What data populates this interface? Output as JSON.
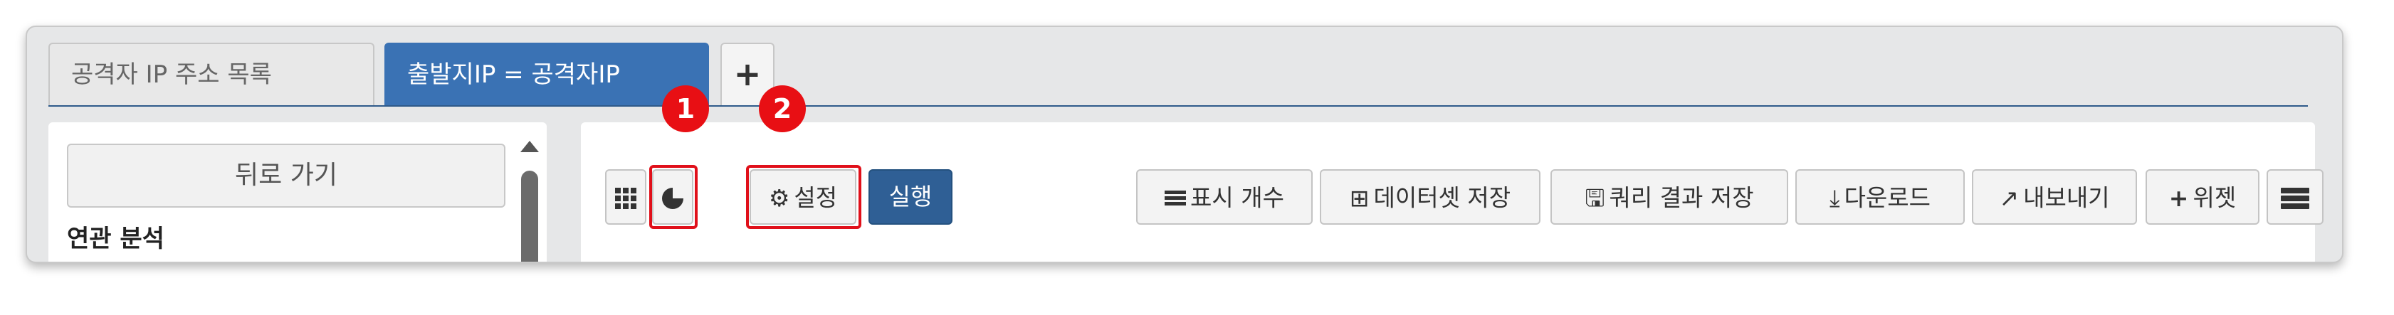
{
  "tabs": [
    {
      "label": "공격자 IP 주소 목록",
      "active": false
    },
    {
      "label": "출발지IP = 공격자IP",
      "active": true
    }
  ],
  "add_tab_label": "+",
  "left_panel": {
    "back_button": "뒤로 가기",
    "section_title": "연관 분석"
  },
  "toolbar": {
    "grid_icon": "grid-icon",
    "chart_icon": "pie-chart-icon",
    "settings_label": "설정",
    "run_label": "실행",
    "display_count_label": "표시 개수",
    "save_dataset_label": "데이터셋 저장",
    "save_query_result_label": "쿼리 결과 저장",
    "download_label": "다운로드",
    "export_label": "내보내기",
    "widget_label": "위젯"
  },
  "callouts": [
    {
      "number": "1"
    },
    {
      "number": "2"
    }
  ],
  "colors": {
    "active_tab": "#3a72b4",
    "run_button": "#2f5f95",
    "callout_red": "#e80f14"
  }
}
